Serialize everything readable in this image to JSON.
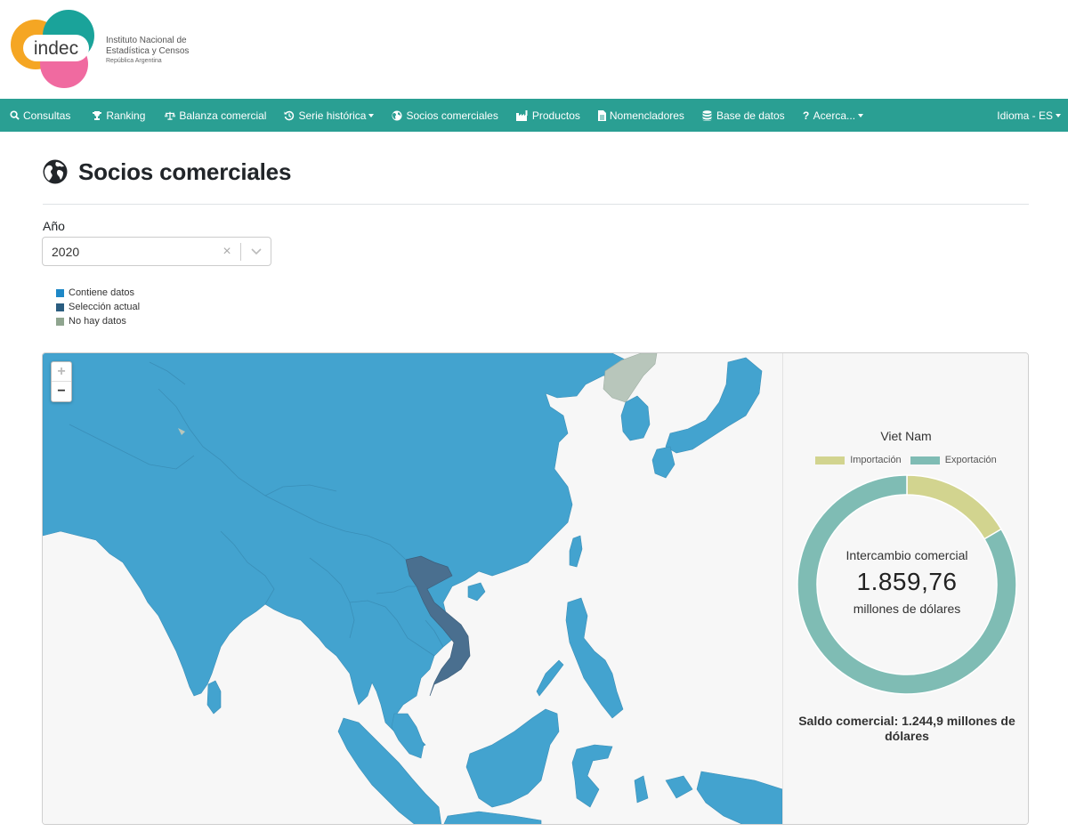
{
  "brand": {
    "logo_text": "indec",
    "line1": "Instituto Nacional de",
    "line2": "Estadística y Censos",
    "line3": "República Argentina"
  },
  "nav": {
    "items": [
      {
        "label": "Consultas",
        "icon": "search-icon"
      },
      {
        "label": "Ranking",
        "icon": "trophy-icon"
      },
      {
        "label": "Balanza comercial",
        "icon": "balance-scale-icon"
      },
      {
        "label": "Serie histórica",
        "icon": "history-icon",
        "dropdown": true
      },
      {
        "label": "Socios comerciales",
        "icon": "globe-icon"
      },
      {
        "label": "Productos",
        "icon": "industry-icon"
      },
      {
        "label": "Nomencladores",
        "icon": "file-icon"
      },
      {
        "label": "Base de datos",
        "icon": "database-icon"
      },
      {
        "label": "Acerca...",
        "icon": "question-icon",
        "dropdown": true
      }
    ],
    "language": "Idioma - ES"
  },
  "page": {
    "title": "Socios comerciales"
  },
  "filter": {
    "year_label": "Año",
    "year_value": "2020"
  },
  "legend": {
    "items": [
      {
        "label": "Contiene datos",
        "color": "#1e88c7"
      },
      {
        "label": "Selección actual",
        "color": "#2b5d80"
      },
      {
        "label": "No hay datos",
        "color": "#8fa58f"
      }
    ]
  },
  "map": {
    "zoom_in": "+",
    "zoom_out": "−",
    "colors": {
      "data": "#43a3cf",
      "selected": "#4a6f8f",
      "nodata": "#b8c6bb",
      "water": "#f7f7f7"
    }
  },
  "detail": {
    "country": "Viet Nam",
    "legend_import": "Importación",
    "legend_export": "Exportación",
    "center_label": "Intercambio comercial",
    "center_value": "1.859,76",
    "center_unit": "millones de dólares",
    "saldo": "Saldo comercial: 1.244,9 millones de dólares"
  },
  "chart_data": {
    "type": "pie",
    "title": "Viet Nam",
    "categories": [
      "Importación",
      "Exportación"
    ],
    "values": [
      307.43,
      1552.33
    ],
    "colors": [
      "#d2d48f",
      "#7fbcb4"
    ]
  }
}
